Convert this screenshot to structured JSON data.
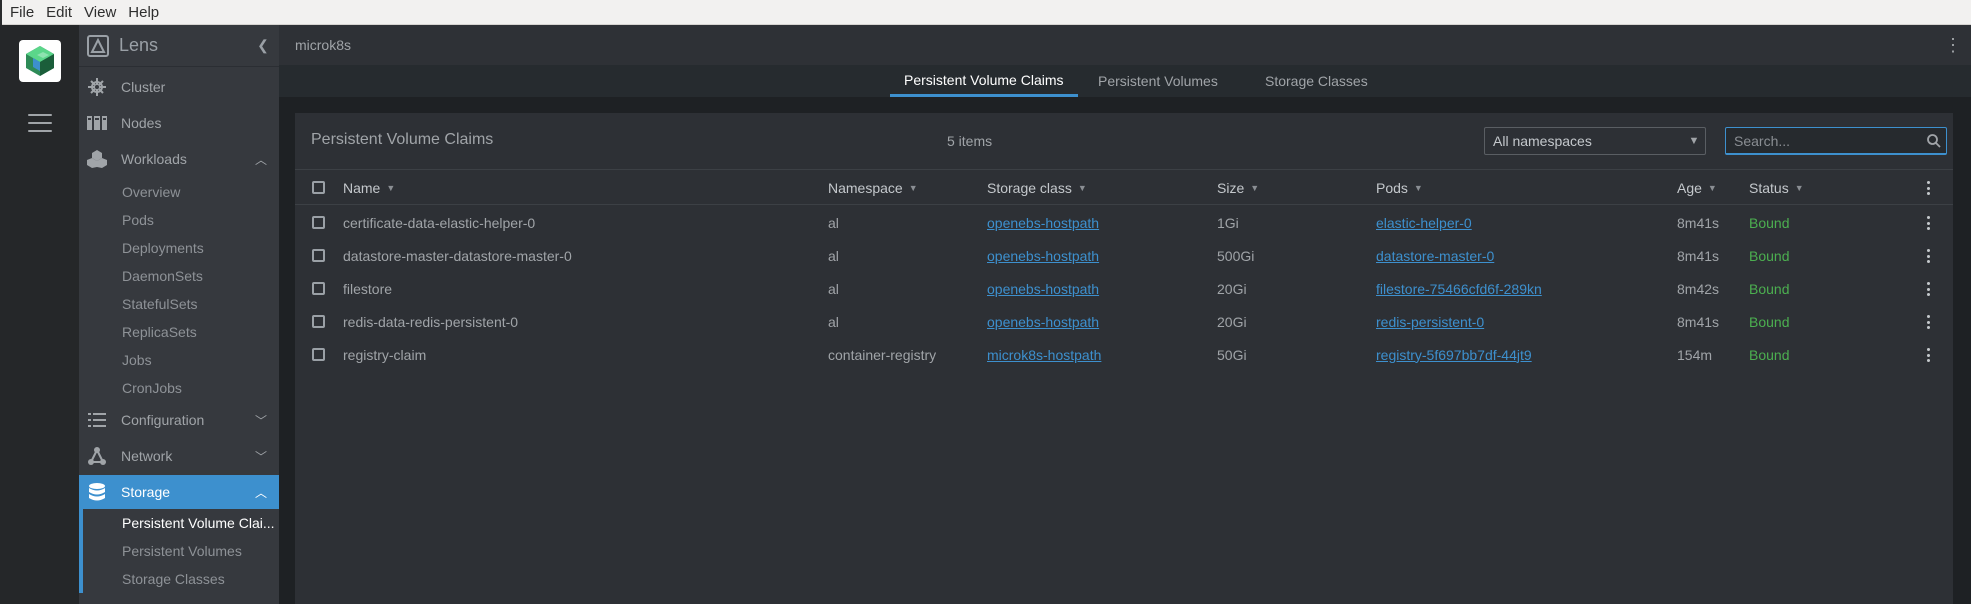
{
  "menubar": {
    "items": [
      "File",
      "Edit",
      "View",
      "Help"
    ]
  },
  "app": {
    "title": "Lens"
  },
  "colors": {
    "accent": "#3d90ce",
    "status_ok": "#4caf50",
    "link": "#3d90ce"
  },
  "sidebar": {
    "items": [
      {
        "label": "Cluster",
        "icon": "helm-icon"
      },
      {
        "label": "Nodes",
        "icon": "nodes-icon"
      },
      {
        "label": "Workloads",
        "icon": "workloads-icon",
        "chevron": "up"
      },
      {
        "label": "Configuration",
        "icon": "list-icon",
        "chevron": "down"
      },
      {
        "label": "Network",
        "icon": "network-icon",
        "chevron": "down"
      },
      {
        "label": "Storage",
        "icon": "database-icon",
        "chevron": "up"
      }
    ],
    "workloads_sub": [
      "Overview",
      "Pods",
      "Deployments",
      "DaemonSets",
      "StatefulSets",
      "ReplicaSets",
      "Jobs",
      "CronJobs"
    ],
    "storage_sub": [
      "Persistent Volume Clai...",
      "Persistent Volumes",
      "Storage Classes"
    ]
  },
  "topbar": {
    "context": "microk8s"
  },
  "tabs": [
    "Persistent Volume Claims",
    "Persistent Volumes",
    "Storage Classes"
  ],
  "panel": {
    "title": "Persistent Volume Claims",
    "count": "5 items",
    "namespace_select": "All namespaces",
    "search_placeholder": "Search..."
  },
  "table": {
    "headers": [
      "Name",
      "Namespace",
      "Storage class",
      "Size",
      "Pods",
      "Age",
      "Status"
    ],
    "rows": [
      {
        "name": "certificate-data-elastic-helper-0",
        "namespace": "al",
        "storage_class": "openebs-hostpath",
        "size": "1Gi",
        "pods": "elastic-helper-0",
        "age": "8m41s",
        "status": "Bound"
      },
      {
        "name": "datastore-master-datastore-master-0",
        "namespace": "al",
        "storage_class": "openebs-hostpath",
        "size": "500Gi",
        "pods": "datastore-master-0",
        "age": "8m41s",
        "status": "Bound"
      },
      {
        "name": "filestore",
        "namespace": "al",
        "storage_class": "openebs-hostpath",
        "size": "20Gi",
        "pods": "filestore-75466cfd6f-289kn",
        "age": "8m42s",
        "status": "Bound"
      },
      {
        "name": "redis-data-redis-persistent-0",
        "namespace": "al",
        "storage_class": "openebs-hostpath",
        "size": "20Gi",
        "pods": "redis-persistent-0",
        "age": "8m41s",
        "status": "Bound"
      },
      {
        "name": "registry-claim",
        "namespace": "container-registry",
        "storage_class": "microk8s-hostpath",
        "size": "50Gi",
        "pods": "registry-5f697bb7df-44jt9",
        "age": "154m",
        "status": "Bound"
      }
    ]
  }
}
